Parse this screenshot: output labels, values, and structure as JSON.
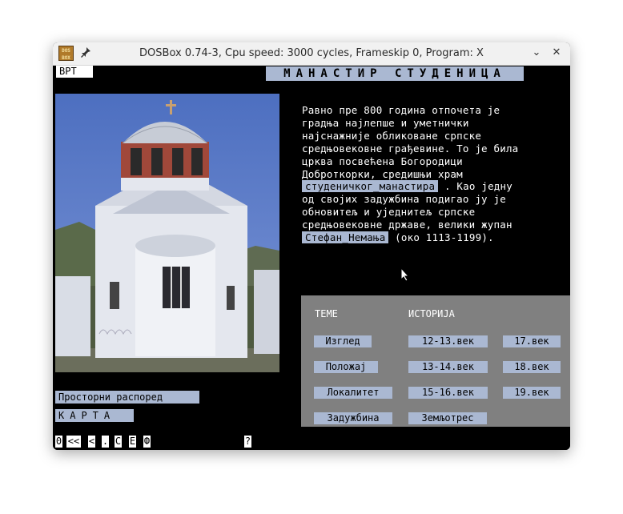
{
  "window": {
    "title": "DOSBox 0.74-3, Cpu speed: 3000 cycles, Frameskip 0, Program: X",
    "app_icon_text": "DOS BOX",
    "minimize_glyph": "⌄",
    "close_glyph": "✕"
  },
  "screen": {
    "vrt_label": "ВРТ",
    "title": "МАНАСТИР СТУДЕНИЦА",
    "paragraph": {
      "line1": "Равно пре 800 година отпочета је",
      "line2": "градња најлепше и уметнички",
      "line3": "најснажније обликоване српске",
      "line4": "средњовековне грађевине. То је била",
      "line5": "црква посвећена Богородици",
      "line6": "Доброткорки, средишњи храм",
      "link1": "студеничког_манастира",
      "line7_rest": ". Као једну",
      "line8": "од својих задужбина подигао ју је",
      "line9": "обновитељ и уједнитељ српске",
      "line10": "средњовековне државе, велики жупан",
      "link2": "Стефан_Немања",
      "line11_rest": "(око 1113-1199)."
    },
    "panel": {
      "themes_header": "ТЕМЕ",
      "history_header": "ИСТОРИЈА",
      "themes": [
        "Изглед",
        "Положај",
        "Локалитет",
        "Задужбина"
      ],
      "history_col1": [
        "12-13.век",
        "13-14.век",
        "15-16.век",
        "Земљотрес"
      ],
      "history_col2": [
        "17.век",
        "18.век",
        "19.век"
      ]
    },
    "left_buttons": {
      "spatial_layout": "Просторни распоред",
      "map": "КАРТА"
    },
    "nav": [
      "0",
      "<<",
      "<",
      ".",
      "C",
      "E",
      "Ф",
      "?"
    ]
  },
  "colors": {
    "screen_bg": "#000000",
    "button_bg": "#aab8d2",
    "panel_bg": "#808080",
    "titlebar_bg": "#f1f1f1"
  }
}
